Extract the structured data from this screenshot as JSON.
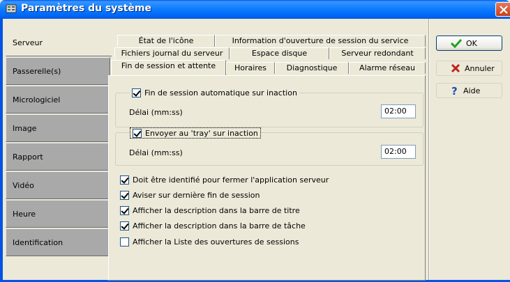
{
  "window": {
    "title": "Paramètres du système",
    "icons": {
      "app": "settings-app-icon",
      "close": "close-icon"
    }
  },
  "nav": {
    "items": [
      {
        "label": "Serveur",
        "active": true
      },
      {
        "label": "Passerelle(s)",
        "active": false
      },
      {
        "label": "Micrologiciel",
        "active": false
      },
      {
        "label": "Image",
        "active": false
      },
      {
        "label": "Rapport",
        "active": false
      },
      {
        "label": "Vidéo",
        "active": false
      },
      {
        "label": "Heure",
        "active": false
      },
      {
        "label": "Identification",
        "active": false
      }
    ]
  },
  "tabs": {
    "row1": [
      {
        "label": "État de l'icône"
      },
      {
        "label": "Information d'ouverture de session du service"
      }
    ],
    "row2": [
      {
        "label": "Fichiers journal du serveur"
      },
      {
        "label": "Espace disque"
      },
      {
        "label": "Serveur redondant"
      }
    ],
    "row3": [
      {
        "label": "Fin de session et attente",
        "active": true
      },
      {
        "label": "Horaires"
      },
      {
        "label": "Diagnostique"
      },
      {
        "label": "Alarme réseau"
      }
    ]
  },
  "group_auto_logout": {
    "legend": "Fin de session automatique sur inaction",
    "checked": true,
    "delay_label": "Délai (mm:ss)",
    "delay_value": "02:00"
  },
  "group_tray": {
    "legend": "Envoyer au 'tray' sur inaction",
    "checked": true,
    "delay_label": "Délai (mm:ss)",
    "delay_value": "02:00"
  },
  "options": [
    {
      "label": "Doit être identifié pour fermer l'application serveur",
      "checked": true
    },
    {
      "label": "Aviser sur dernière fin de session",
      "checked": true
    },
    {
      "label": "Afficher la description dans la barre de titre",
      "checked": true
    },
    {
      "label": "Afficher la description dans la barre de tâche",
      "checked": true
    },
    {
      "label": "Afficher la Liste des ouvertures de sessions",
      "checked": false
    }
  ],
  "buttons": {
    "ok": "OK",
    "cancel": "Annuler",
    "help": "Aide"
  },
  "colors": {
    "titlebar": "#0a5fe8",
    "nav_inactive": "#a9a9a9",
    "dialog_bg": "#ece9d8",
    "ok_check": "#21a121",
    "cancel_x": "#c0211e",
    "help_q": "#1f4fb4"
  }
}
